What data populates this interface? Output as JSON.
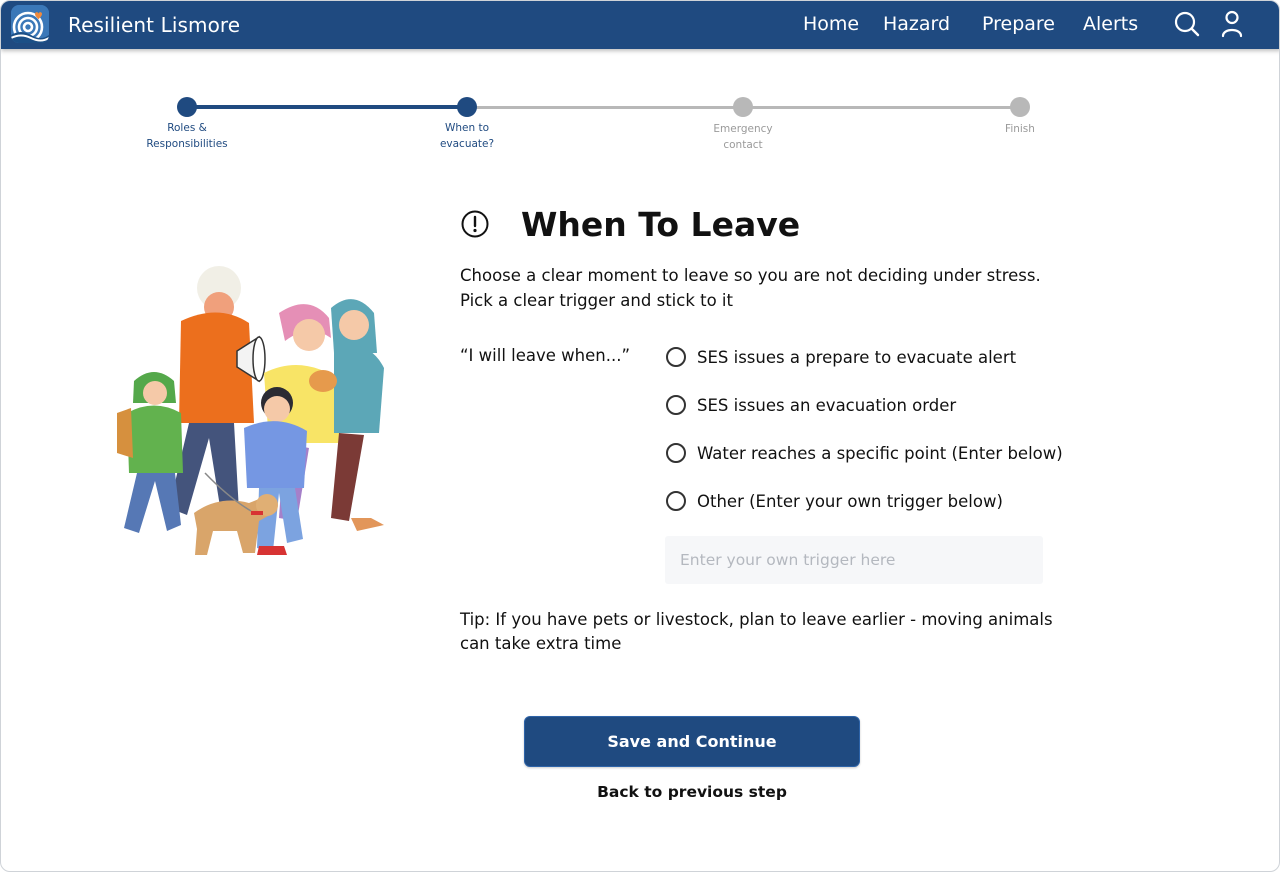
{
  "app": {
    "brand": "Resilient Lismore"
  },
  "nav": {
    "items": [
      "Home",
      "Hazard",
      "Prepare",
      "Alerts"
    ]
  },
  "stepper": {
    "steps": [
      {
        "line1": "Roles &",
        "line2": "Responsibilities",
        "status": "done"
      },
      {
        "line1": "When to",
        "line2": "evacuate?",
        "status": "current"
      },
      {
        "line1": "Emergency",
        "line2": "contact",
        "status": "todo"
      },
      {
        "line1": "Finish",
        "line2": "",
        "status": "todo"
      }
    ]
  },
  "content": {
    "title": "When To Leave",
    "intro": "Choose a clear moment to leave so you are not deciding under stress. Pick a clear trigger and stick to it",
    "prompt": "“I will leave when...”",
    "options": [
      "SES issues a prepare to evacuate alert",
      "SES issues an evacuation order",
      "Water reaches a specific point (Enter below)",
      "Other (Enter your own trigger below)"
    ],
    "trigger_input": {
      "placeholder": "Enter your own trigger here",
      "value": ""
    },
    "tip": "Tip: If you have pets or livestock, plan to leave earlier - moving animals can take extra time"
  },
  "actions": {
    "save_label": "Save and Continue",
    "back_label": "Back to previous step"
  },
  "colors": {
    "primary": "#1f4a80",
    "inactive": "#b8b8b8"
  }
}
